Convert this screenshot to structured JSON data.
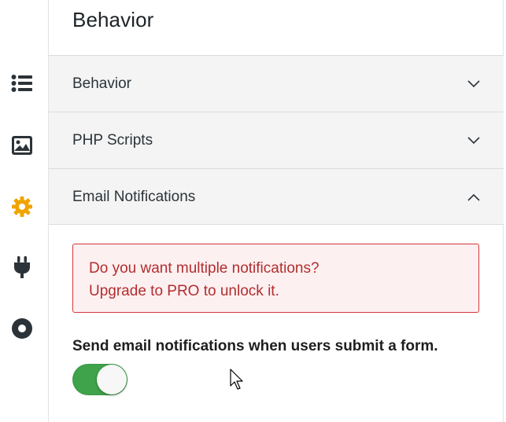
{
  "panel": {
    "title": "Behavior"
  },
  "sidebar": {
    "items": [
      {
        "icon": "list-icon",
        "active": false
      },
      {
        "icon": "image-icon",
        "active": false
      },
      {
        "icon": "gear-icon",
        "active": true
      },
      {
        "icon": "plug-icon",
        "active": false
      },
      {
        "icon": "circle-dot-icon",
        "active": false
      }
    ]
  },
  "sections": [
    {
      "label": "Behavior",
      "expanded": false
    },
    {
      "label": "PHP Scripts",
      "expanded": false
    },
    {
      "label": "Email Notifications",
      "expanded": true
    }
  ],
  "email_notifications": {
    "upgrade_notice": {
      "line1": "Do you want multiple notifications?",
      "line2": "Upgrade to PRO to unlock it."
    },
    "send_label": "Send email notifications when users submit a form.",
    "toggle_on": true
  },
  "colors": {
    "active_icon": "#f0a400",
    "icon": "#2c3338",
    "toggle_on": "#3ea34a",
    "notice_text": "#b32d2e",
    "notice_border": "#d63638",
    "notice_bg": "#fcf0f1"
  }
}
